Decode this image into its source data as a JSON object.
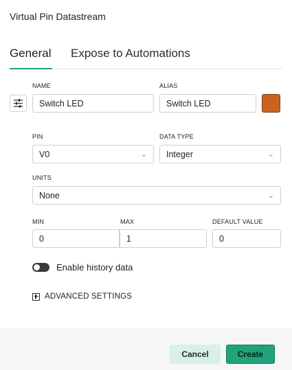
{
  "dialog": {
    "title": "Virtual Pin Datastream"
  },
  "tabs": [
    {
      "label": "General",
      "active": true
    },
    {
      "label": "Expose to Automations",
      "active": false
    }
  ],
  "form": {
    "name": {
      "label": "NAME",
      "value": "Switch LED"
    },
    "alias": {
      "label": "ALIAS",
      "value": "Switch LED"
    },
    "color": {
      "value": "#c8641f"
    },
    "pin": {
      "label": "PIN",
      "value": "V0"
    },
    "data_type": {
      "label": "DATA TYPE",
      "value": "Integer"
    },
    "units": {
      "label": "UNITS",
      "value": "None"
    },
    "min": {
      "label": "MIN",
      "value": "0"
    },
    "max": {
      "label": "MAX",
      "value": "1"
    },
    "default_value": {
      "label": "DEFAULT VALUE",
      "value": "0"
    },
    "history": {
      "label": "Enable history data",
      "enabled": false
    },
    "advanced": {
      "label": "ADVANCED SETTINGS"
    }
  },
  "icons": {
    "icon_picker": "sliders-icon",
    "select": "chevron-down-icon",
    "advanced": "plus-square-icon"
  },
  "footer": {
    "cancel_label": "Cancel",
    "create_label": "Create"
  },
  "colors": {
    "accent": "#1fa37a",
    "cancel_bg": "#d9f0e6"
  }
}
